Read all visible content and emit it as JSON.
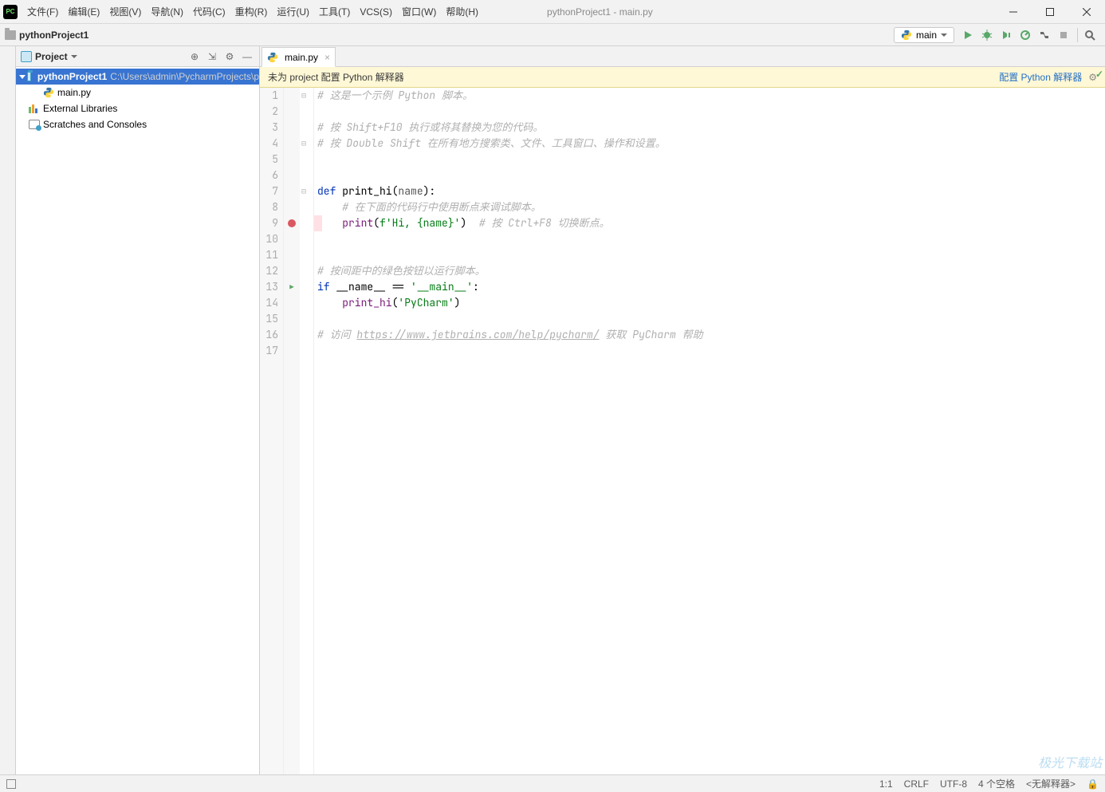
{
  "window_title": "pythonProject1 - main.py",
  "menu": [
    "文件(F)",
    "编辑(E)",
    "视图(V)",
    "导航(N)",
    "代码(C)",
    "重构(R)",
    "运行(U)",
    "工具(T)",
    "VCS(S)",
    "窗口(W)",
    "帮助(H)"
  ],
  "breadcrumb_project": "pythonProject1",
  "run_config": "main",
  "project_panel": {
    "label": "Project",
    "root": {
      "name": "pythonProject1",
      "path": "C:\\Users\\admin\\PycharmProjects\\p"
    },
    "file": "main.py",
    "ext_lib": "External Libraries",
    "scratches": "Scratches and Consoles"
  },
  "tab": {
    "name": "main.py"
  },
  "banner": {
    "msg": "未为 project 配置 Python 解释器",
    "link": "配置 Python 解释器"
  },
  "code_lines": 17,
  "code": {
    "l1": "# 这是一个示例 Python 脚本。",
    "l3": "# 按 Shift+F10 执行或将其替换为您的代码。",
    "l4": "# 按 Double Shift 在所有地方搜索类、文件、工具窗口、操作和设置。",
    "l7_def": "def ",
    "l7_fn": "print_hi",
    "l7_p": "(",
    "l7_par": "name",
    "l7_e": "):",
    "l8": "    # 在下面的代码行中使用断点来调试脚本。",
    "l9_a": "    ",
    "l9_fn": "print",
    "l9_p": "(",
    "l9_s": "f'Hi, {name}'",
    "l9_e": ")",
    "l9_c": "  # 按 Ctrl+F8 切换断点。",
    "l12": "# 按间距中的绿色按钮以运行脚本。",
    "l13_if": "if ",
    "l13_nm": "__name__",
    "l13_eq": " == ",
    "l13_s": "'__main__'",
    "l13_c": ":",
    "l14_a": "    ",
    "l14_fn": "print_hi",
    "l14_p": "(",
    "l14_s": "'PyCharm'",
    "l14_e": ")",
    "l16_a": "# 访问 ",
    "l16_url": "https://www.jetbrains.com/help/pycharm/",
    "l16_b": " 获取 PyCharm 帮助"
  },
  "status": {
    "pos": "1:1",
    "eol": "CRLF",
    "enc": "UTF-8",
    "indent": "4 个空格",
    "interp": "<无解释器>"
  },
  "icon_glyphs": {
    "min": "─",
    "max": "☐",
    "close": "✕",
    "gear": "⚙",
    "search": "⌕",
    "collapse": "⇲",
    "target": "⊕"
  }
}
